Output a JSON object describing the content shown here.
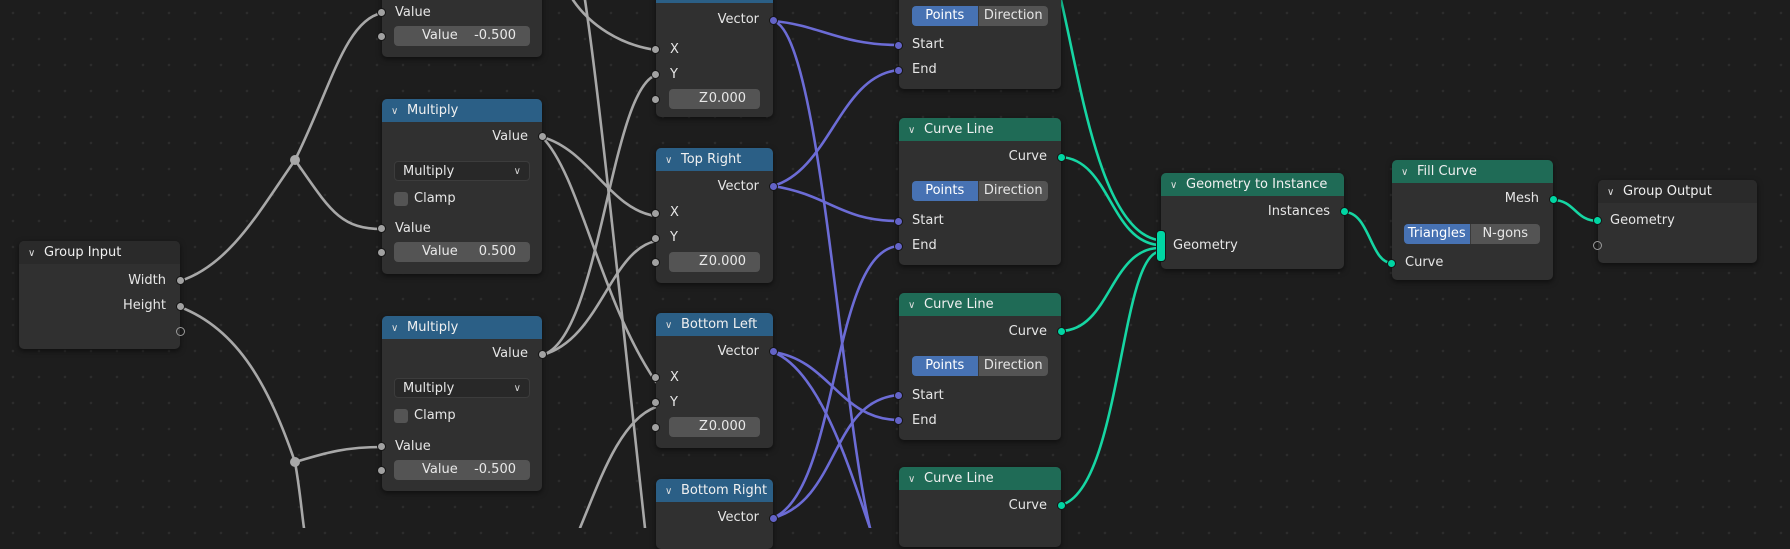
{
  "colors": {
    "canvas": "#1d1d1d",
    "math_header": "#2b5f86",
    "geometry_header": "#1f6b56",
    "float_socket": "#a1a1a1",
    "vector_socket": "#6363c7",
    "geometry_socket": "#00d6a3",
    "active_toggle": "#4772b3"
  },
  "nodes": {
    "top_math": {
      "output": "Value",
      "field_label": "Value",
      "field_value": "-0.500"
    },
    "multiply_1": {
      "title": "Multiply",
      "output": "Value",
      "operation": "Multiply",
      "clamp": "Clamp",
      "input": "Value",
      "field_label": "Value",
      "field_value": "0.500"
    },
    "multiply_2": {
      "title": "Multiply",
      "output": "Value",
      "operation": "Multiply",
      "clamp": "Clamp",
      "input": "Value",
      "field_label": "Value",
      "field_value": "-0.500"
    },
    "group_input": {
      "title": "Group Input",
      "width": "Width",
      "height": "Height"
    },
    "top_left": {
      "output": "Vector",
      "x": "X",
      "y": "Y",
      "z_label": "Z",
      "z_value": "0.000"
    },
    "top_right": {
      "title": "Top Right",
      "output": "Vector",
      "x": "X",
      "y": "Y",
      "z_label": "Z",
      "z_value": "0.000"
    },
    "bottom_left": {
      "title": "Bottom Left",
      "output": "Vector",
      "x": "X",
      "y": "Y",
      "z_label": "Z",
      "z_value": "0.000"
    },
    "bottom_right": {
      "title": "Bottom Right",
      "output": "Vector"
    },
    "curve_line_0": {
      "mode_a": "Points",
      "mode_b": "Direction",
      "start": "Start",
      "end": "End"
    },
    "curve_line_1": {
      "title": "Curve Line",
      "output": "Curve",
      "mode_a": "Points",
      "mode_b": "Direction",
      "start": "Start",
      "end": "End"
    },
    "curve_line_2": {
      "title": "Curve Line",
      "output": "Curve",
      "mode_a": "Points",
      "mode_b": "Direction",
      "start": "Start",
      "end": "End"
    },
    "curve_line_3": {
      "title": "Curve Line",
      "output": "Curve"
    },
    "geo_to_instance": {
      "title": "Geometry to Instance",
      "output": "Instances",
      "input": "Geometry"
    },
    "fill_curve": {
      "title": "Fill Curve",
      "output": "Mesh",
      "mode_a": "Triangles",
      "mode_b": "N-gons",
      "input": "Curve"
    },
    "group_output": {
      "title": "Group Output",
      "input": "Geometry"
    }
  }
}
